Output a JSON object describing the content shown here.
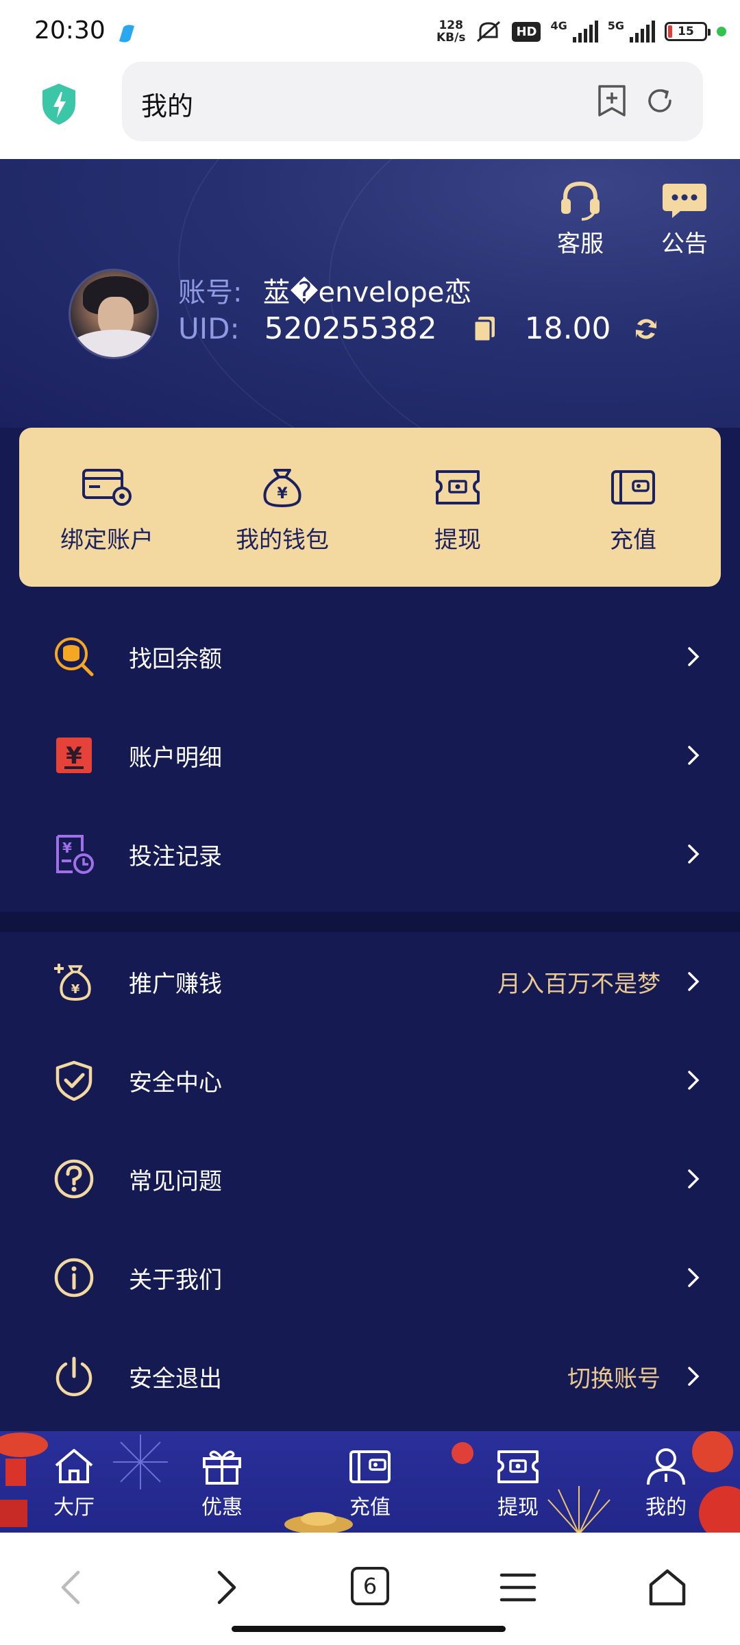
{
  "status_bar": {
    "time": "20:30",
    "net_speed_top": "128",
    "net_speed_bottom": "KB/s",
    "hd": "HD",
    "sig1": "4G",
    "sig2": "5G",
    "battery": "15"
  },
  "browser": {
    "url_text": "我的",
    "tab_count": "6"
  },
  "header": {
    "service_label": "客服",
    "notice_label": "公告",
    "account_label": "账号:",
    "account_name": "莁�envelope恋",
    "uid_label": "UID:",
    "uid_value": "520255382",
    "balance": "18.00"
  },
  "quick_actions": [
    {
      "label": "绑定账户"
    },
    {
      "label": "我的钱包"
    },
    {
      "label": "提现"
    },
    {
      "label": "充值"
    }
  ],
  "menu_section_1": [
    {
      "label": "找回余额",
      "extra": ""
    },
    {
      "label": "账户明细",
      "extra": ""
    },
    {
      "label": "投注记录",
      "extra": ""
    }
  ],
  "menu_section_2": [
    {
      "label": "推广赚钱",
      "extra": "月入百万不是梦"
    },
    {
      "label": "安全中心",
      "extra": ""
    },
    {
      "label": "常见问题",
      "extra": ""
    },
    {
      "label": "关于我们",
      "extra": ""
    },
    {
      "label": "安全退出",
      "extra": "切换账号"
    }
  ],
  "tabbar": [
    {
      "label": "大厅"
    },
    {
      "label": "优惠"
    },
    {
      "label": "充值"
    },
    {
      "label": "提现"
    },
    {
      "label": "我的"
    }
  ],
  "colors": {
    "accent_gold": "#f3d9a0",
    "bg_navy": "#151a52",
    "tab_blue": "#2a2f9a"
  }
}
